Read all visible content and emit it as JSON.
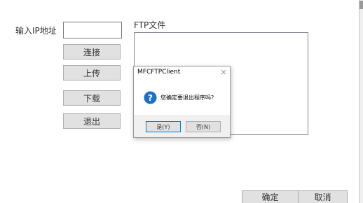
{
  "form": {
    "ip_label": "输入IP地址",
    "ip_value": "",
    "files_label": "FTP文件",
    "connect_label": "连接",
    "upload_label": "上传",
    "download_label": "下载",
    "exit_label": "退出",
    "ok_label": "确定",
    "cancel_label": "取消"
  },
  "dialog": {
    "title": "MFCFTPClient",
    "close_glyph": "✕",
    "message": "您确定要退出程序吗?",
    "yes_label": "是(Y)",
    "no_label": "否(N)",
    "icon": "question-icon"
  },
  "colors": {
    "icon_blue": "#1f6fc6",
    "focus_border": "#0078d7",
    "button_face": "#e1e1e1"
  }
}
